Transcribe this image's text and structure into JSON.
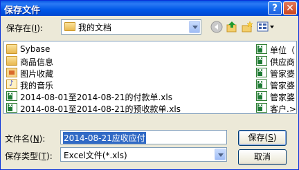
{
  "window": {
    "title": "保存文件",
    "help_icon": "?",
    "close_icon": "✕"
  },
  "save_in": {
    "label_prefix": "保存在(",
    "label_key": "I",
    "label_suffix": "):",
    "value": "我的文档"
  },
  "toolbar": {
    "icons": [
      "back-icon",
      "up-folder-icon",
      "new-folder-icon",
      "views-menu-icon"
    ]
  },
  "files_left": [
    {
      "name": "Sybase",
      "icon": "folder-icon"
    },
    {
      "name": "商品信息",
      "icon": "folder-icon"
    },
    {
      "name": "图片收藏",
      "icon": "picture-folder-icon"
    },
    {
      "name": "我的音乐",
      "icon": "music-folder-icon"
    },
    {
      "name": "2014-08-01至2014-08-21的付款单.xls",
      "icon": "excel-file-icon"
    },
    {
      "name": "2014-08-01至2014-08-21的预收款单.xls",
      "icon": "excel-file-icon"
    }
  ],
  "files_right": [
    {
      "name": "单位（",
      "icon": "excel-file-icon"
    },
    {
      "name": "供应商",
      "icon": "excel-file-icon"
    },
    {
      "name": "管家婆",
      "icon": "excel-file-icon"
    },
    {
      "name": "管家婆",
      "icon": "excel-file-icon"
    },
    {
      "name": "管家婆",
      "icon": "excel-file-icon"
    },
    {
      "name": "客户.>",
      "icon": "excel-file-icon"
    }
  ],
  "file_name": {
    "label_prefix": "文件名(",
    "label_key": "N",
    "label_suffix": "):",
    "value": "2014-08-21应收应付"
  },
  "file_type": {
    "label_prefix": "保存类型(",
    "label_key": "T",
    "label_suffix": "):",
    "value": "Excel文件(*.xls)"
  },
  "buttons": {
    "save_prefix": "保存(",
    "save_key": "S",
    "save_suffix": ")",
    "cancel": "取消"
  }
}
